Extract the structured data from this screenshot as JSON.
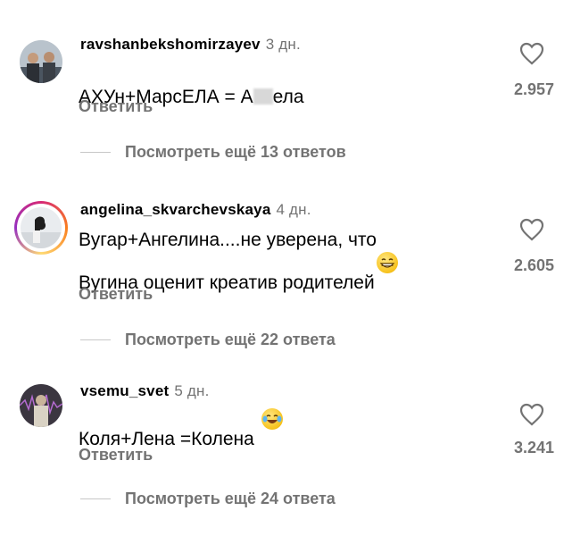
{
  "comments": [
    {
      "username": "ravshanbekshomirzayev",
      "time": "3 дн.",
      "text_before": "АХУн+МарсЕЛА = А",
      "text_after": "ела",
      "reply_label": "Ответить",
      "likes": "2.957",
      "more_replies": "Посмотреть ещё 13 ответов"
    },
    {
      "username": "angelina_skvarchevskaya",
      "time": "4 дн.",
      "text": "Вугар+Ангелина....не уверена, что\nВугина оценит креатив родителей",
      "emoji": "grinning-face",
      "reply_label": "Ответить",
      "likes": "2.605",
      "more_replies": "Посмотреть ещё 22 ответа"
    },
    {
      "username": "vsemu_svet",
      "time": "5 дн.",
      "text": "Коля+Лена =Колена",
      "emoji": "tears-of-joy-face",
      "reply_label": "Ответить",
      "likes": "3.241",
      "more_replies": "Посмотреть ещё 24 ответа"
    }
  ],
  "icons": {
    "like": "heart-outline-icon"
  },
  "colors": {
    "secondary_text": "#737373",
    "divider": "#c7c7c7"
  }
}
